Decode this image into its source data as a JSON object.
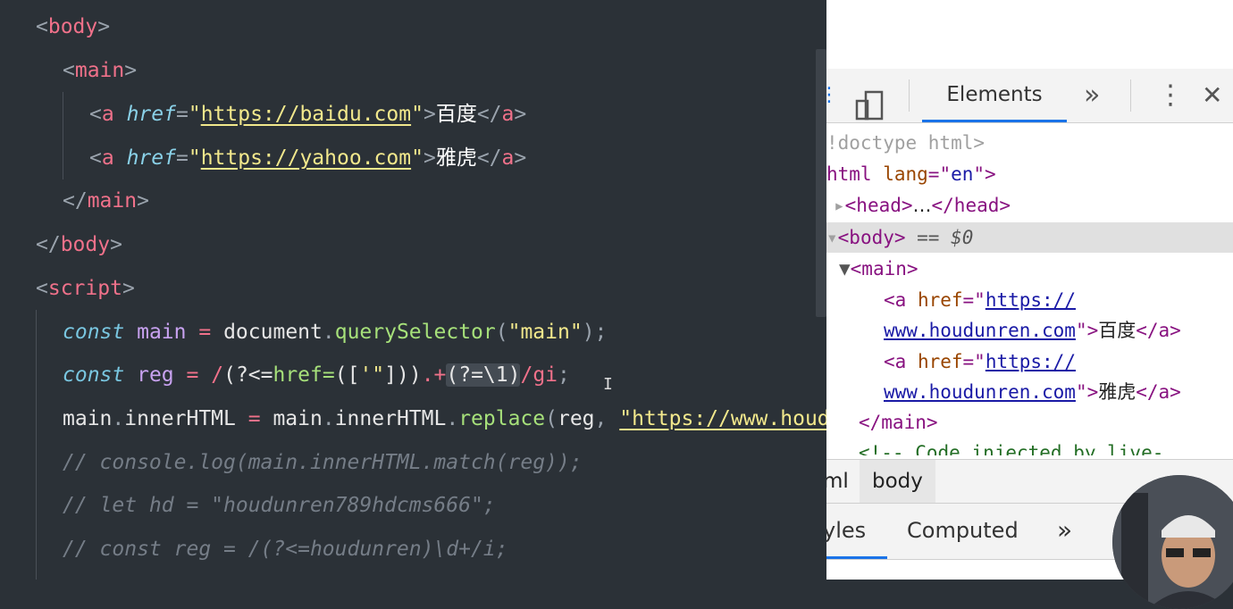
{
  "editor": {
    "lines": {
      "l1": {
        "open": "<",
        "tag": "body",
        "close": ">"
      },
      "l2": {
        "open": "<",
        "tag": "main",
        "close": ">"
      },
      "l3": {
        "open": "<",
        "tag": "a",
        "attr": "href",
        "eq": "=",
        "q1": "\"",
        "url": "https://baidu.com",
        "q2": "\"",
        "gt": ">",
        "text": "百度",
        "endopen": "</",
        "endtag": "a",
        "endclose": ">"
      },
      "l4": {
        "open": "<",
        "tag": "a",
        "attr": "href",
        "eq": "=",
        "q1": "\"",
        "url": "https://yahoo.com",
        "q2": "\"",
        "gt": ">",
        "text": "雅虎",
        "endopen": "</",
        "endtag": "a",
        "endclose": ">"
      },
      "l5": {
        "open": "</",
        "tag": "main",
        "close": ">"
      },
      "l6": {
        "open": "</",
        "tag": "body",
        "close": ">"
      },
      "l7": {
        "open": "<",
        "tag": "script",
        "close": ">"
      },
      "l8": {
        "kw": "const",
        "var": "main",
        "op": "=",
        "obj": "document",
        "dot": ".",
        "fn": "querySelector",
        "p1": "(",
        "str": "\"main\"",
        "p2": ");"
      },
      "l9": {
        "kw": "const",
        "var": "reg",
        "op": "=",
        "slash": "/",
        "g1": "(?<=",
        "href": "href=",
        "g2": "([",
        "chars": "'\"",
        "g3": "]))",
        "any": ".+",
        "look": "(?=\\1)",
        "flags": "/gi",
        "semi": ";"
      },
      "l10": {
        "obj": "main",
        "dot1": ".",
        "prop": "innerHTML",
        "op": "=",
        "obj2": "main",
        "dot2": ".",
        "prop2": "innerHTML",
        "dot3": ".",
        "fn": "replace",
        "p1": "(",
        "arg": "reg",
        "comma": ", ",
        "str": "\"https://www.houdunren.com\""
      },
      "l11": {
        "cmt": "// console.log(main.innerHTML.match(reg));"
      },
      "l12": {
        "cmt": "// let hd = \"houdunren789hdcms666\";"
      },
      "l13": {
        "cmt": "// const reg = /(?<=houdunren)\\d+/i;"
      }
    }
  },
  "devtools": {
    "tab_label": "Elements",
    "more_tabs_icon": "»",
    "menu_icon": "⋮",
    "close_icon": "✕",
    "tree": {
      "doctype": "!doctype html>",
      "html_open": "html ",
      "html_attr": "lang",
      "html_eq": "=\"",
      "html_val": "en",
      "html_close": "\">",
      "head": "<head>",
      "head_ellipsis": "…",
      "head_close": "</head>",
      "body": "<body>",
      "body_marker": " == $0",
      "main": "<main>",
      "a_open": "<a ",
      "a_attr": "href",
      "a_eq": "=\"",
      "link1a": "https://",
      "link1b": "www.houdunren.com",
      "a1_end": "\">",
      "a1_text": "百度",
      "a_close": "</a>",
      "link2a": "https://",
      "link2b": "www.houdunren.com",
      "a2_end": "\">",
      "a2_text": "雅虎",
      "main_close": "</main>",
      "comment": "<!-- Code injected by live-"
    },
    "breadcrumbs": {
      "html": "ml",
      "body": "body"
    },
    "style_tabs": {
      "styles": "yles",
      "computed": "Computed",
      "more": "»"
    }
  }
}
